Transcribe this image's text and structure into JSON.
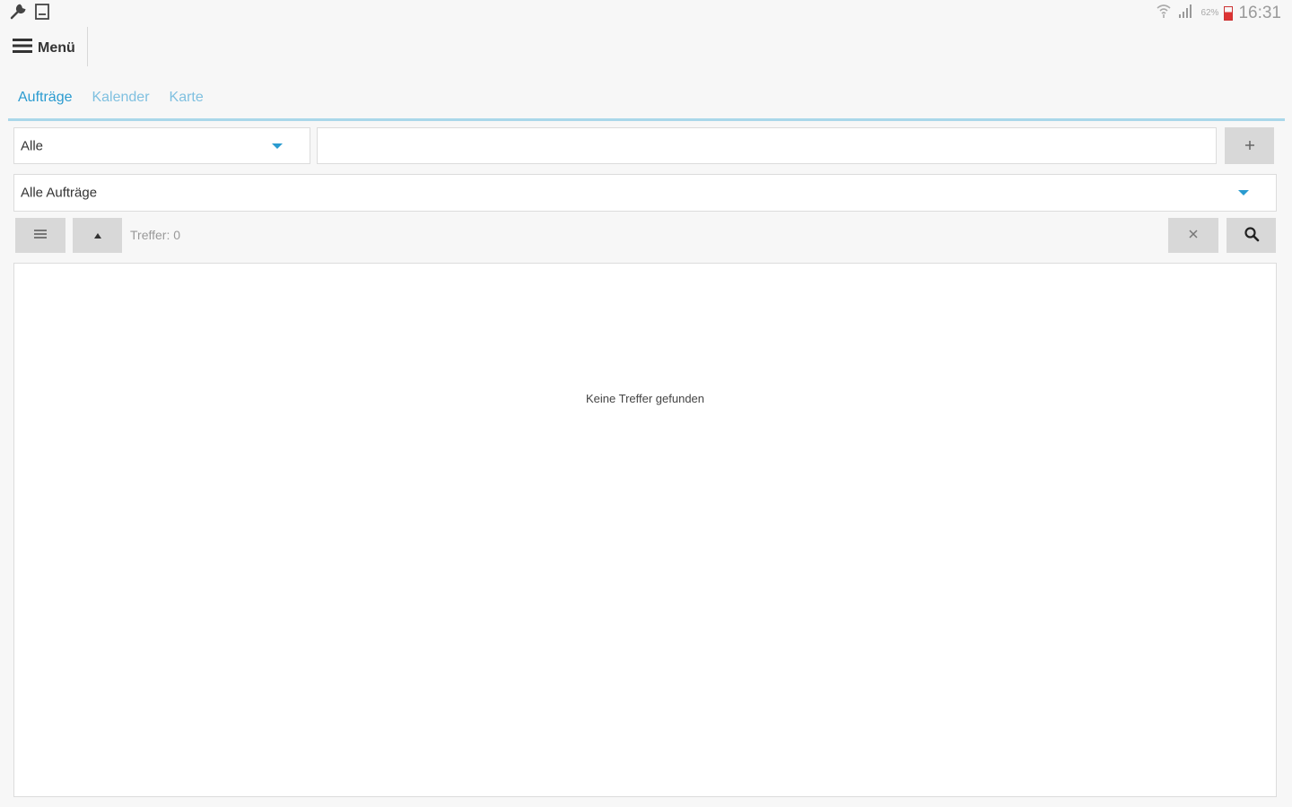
{
  "statusbar": {
    "left_icons": [
      "wrench-icon",
      "clipboard-icon"
    ],
    "right_icons": [
      "wifi-icon",
      "signal-icon",
      "battery-icon"
    ],
    "battery_percent": "62%",
    "time": "16:31"
  },
  "menu": {
    "icon": "hamburger-icon",
    "label": "Menü"
  },
  "tabs": [
    {
      "label": "Aufträge",
      "active": true
    },
    {
      "label": "Kalender",
      "active": false
    },
    {
      "label": "Karte",
      "active": false
    }
  ],
  "filter": {
    "scope_select_value": "Alle",
    "search_value": "",
    "add_icon": "plus-icon",
    "orders_select_value": "Alle Aufträge"
  },
  "toolbar": {
    "list_icon": "list-icon",
    "sort_icon": "sort-up-icon",
    "hits_label": "Treffer: 0",
    "clear_icon": "close-icon",
    "search_icon": "search-icon"
  },
  "results": {
    "empty_message": "Keine Treffer gefunden"
  },
  "colors": {
    "accent": "#2a9bd0",
    "tab_inactive": "#7fc0e0",
    "tab_line": "#a9d7ea",
    "button_bg": "#d8d8d8"
  }
}
